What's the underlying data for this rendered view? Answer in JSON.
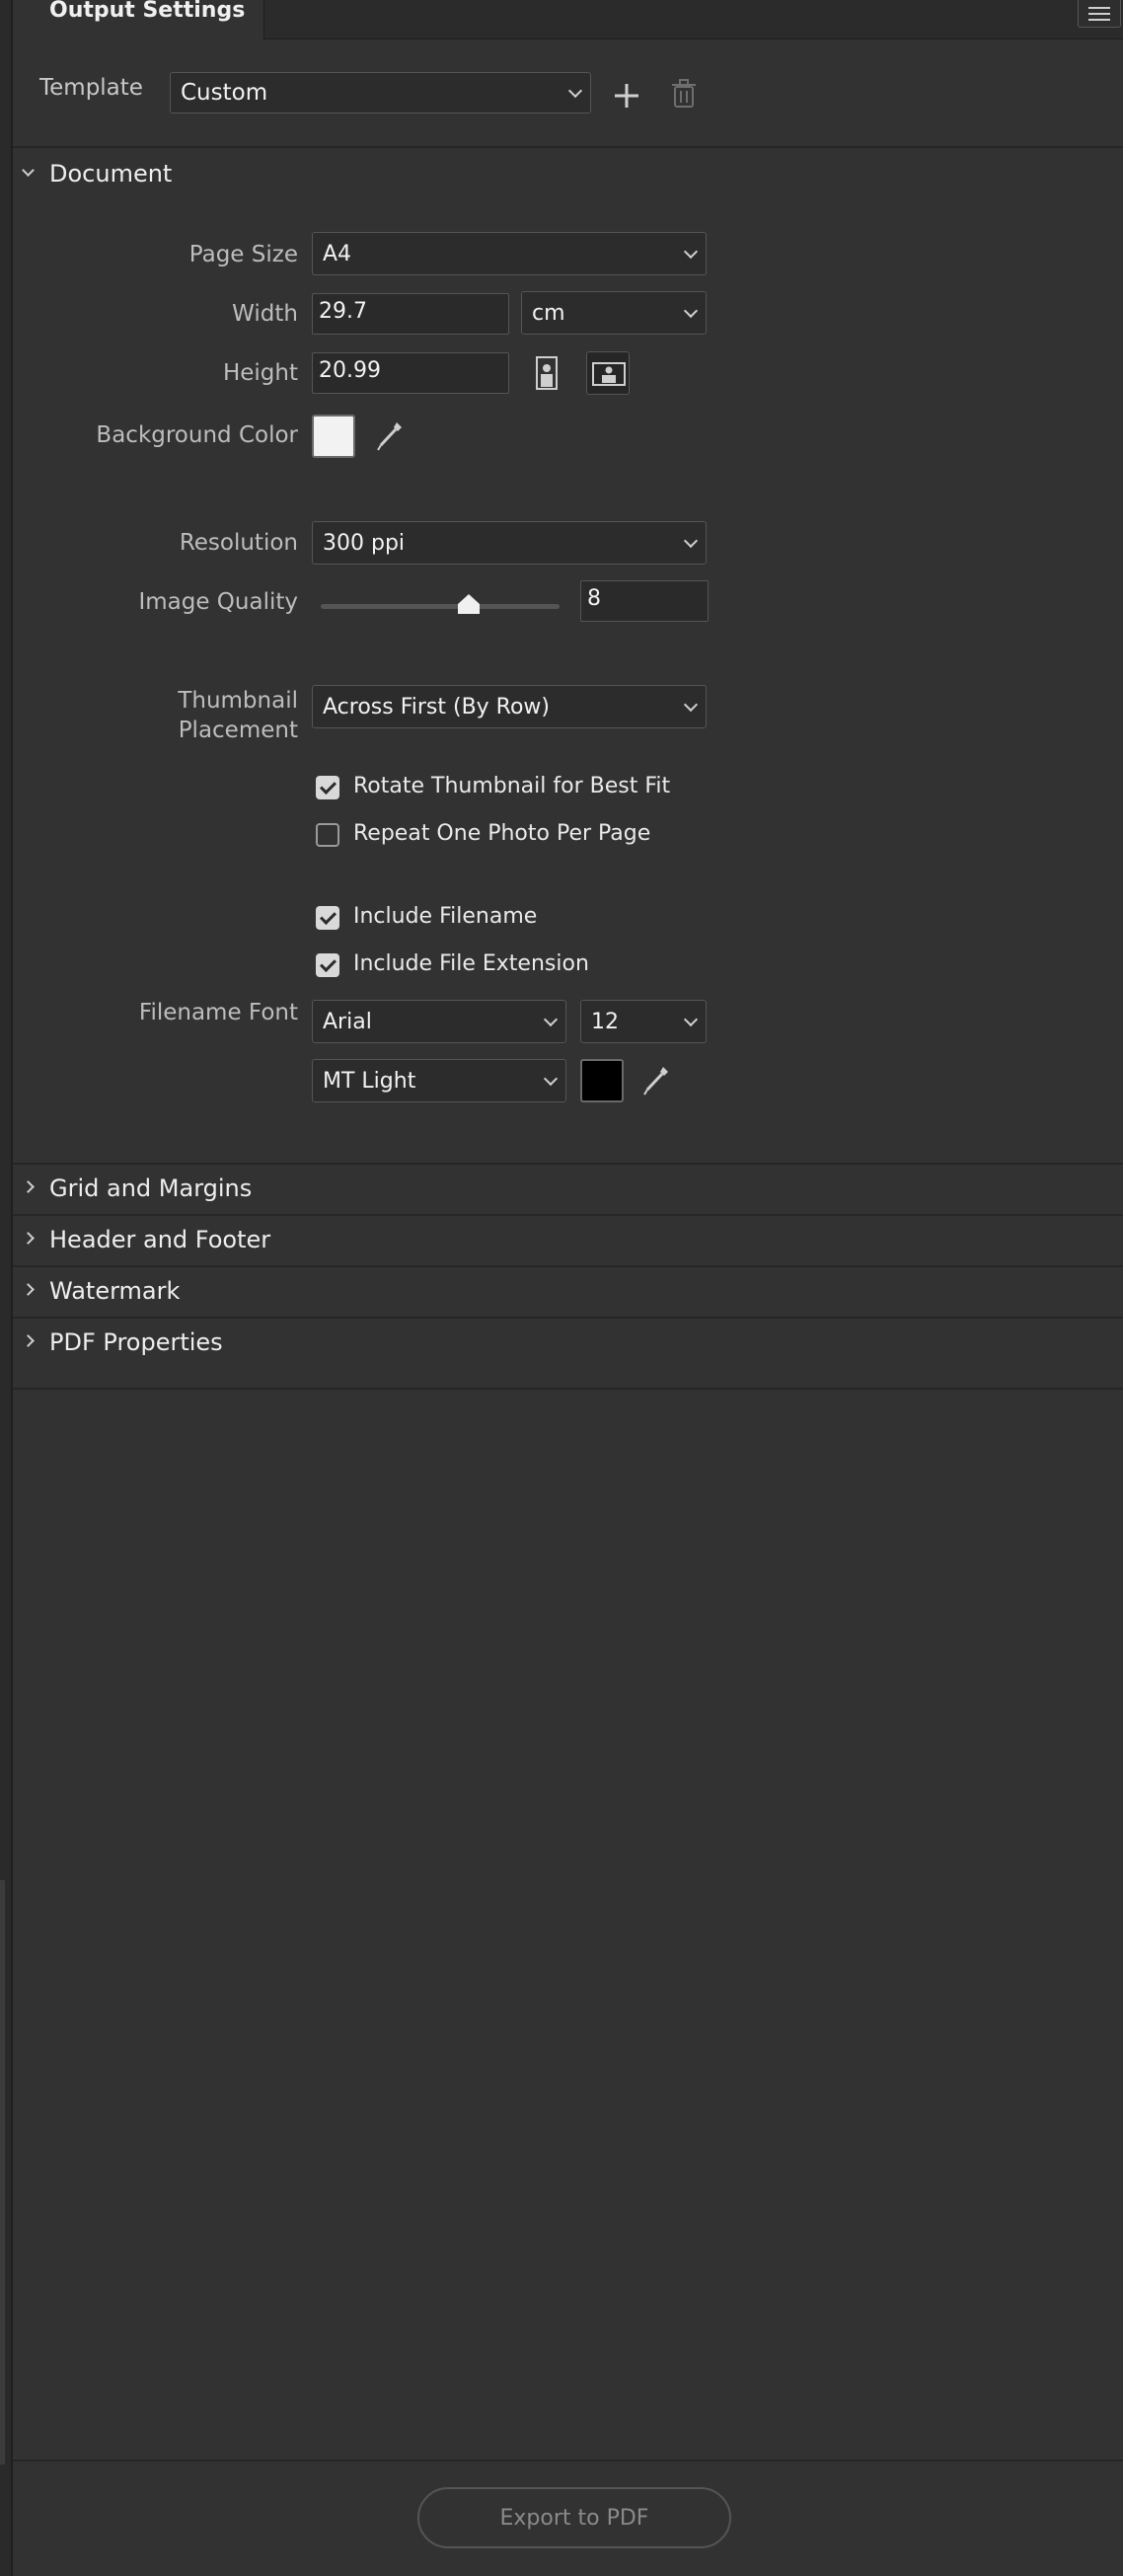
{
  "tab": {
    "title": "Output Settings"
  },
  "template": {
    "label": "Template",
    "value": "Custom"
  },
  "document": {
    "title": "Document",
    "page_size": {
      "label": "Page Size",
      "value": "A4"
    },
    "width": {
      "label": "Width",
      "value": "29.7",
      "unit": "cm"
    },
    "height": {
      "label": "Height",
      "value": "20.99"
    },
    "background_color": {
      "label": "Background Color",
      "color": "#f2f2f2"
    },
    "resolution": {
      "label": "Resolution",
      "value": "300 ppi"
    },
    "image_quality": {
      "label": "Image Quality",
      "value": "8",
      "slider_fraction": 0.62
    },
    "thumbnail_placement": {
      "label_line1": "Thumbnail",
      "label_line2": "Placement",
      "value": "Across First (By Row)"
    },
    "rotate_thumbnail": {
      "label": "Rotate Thumbnail for Best Fit",
      "checked": true
    },
    "repeat_one_photo": {
      "label": "Repeat One Photo Per Page",
      "checked": false
    },
    "include_filename": {
      "label": "Include Filename",
      "checked": true
    },
    "include_file_extension": {
      "label": "Include File Extension",
      "checked": true
    },
    "filename_font": {
      "label": "Filename Font",
      "family": "Arial",
      "size": "12",
      "style": "MT Light",
      "color": "#000000"
    }
  },
  "sections": [
    {
      "title": "Grid and Margins"
    },
    {
      "title": "Header and Footer"
    },
    {
      "title": "Watermark"
    },
    {
      "title": "PDF Properties"
    }
  ],
  "footer": {
    "export_label": "Export to PDF"
  },
  "colors": {
    "panel_bg": "#323232",
    "field_bg": "#2c2c2c",
    "border": "#555555"
  }
}
